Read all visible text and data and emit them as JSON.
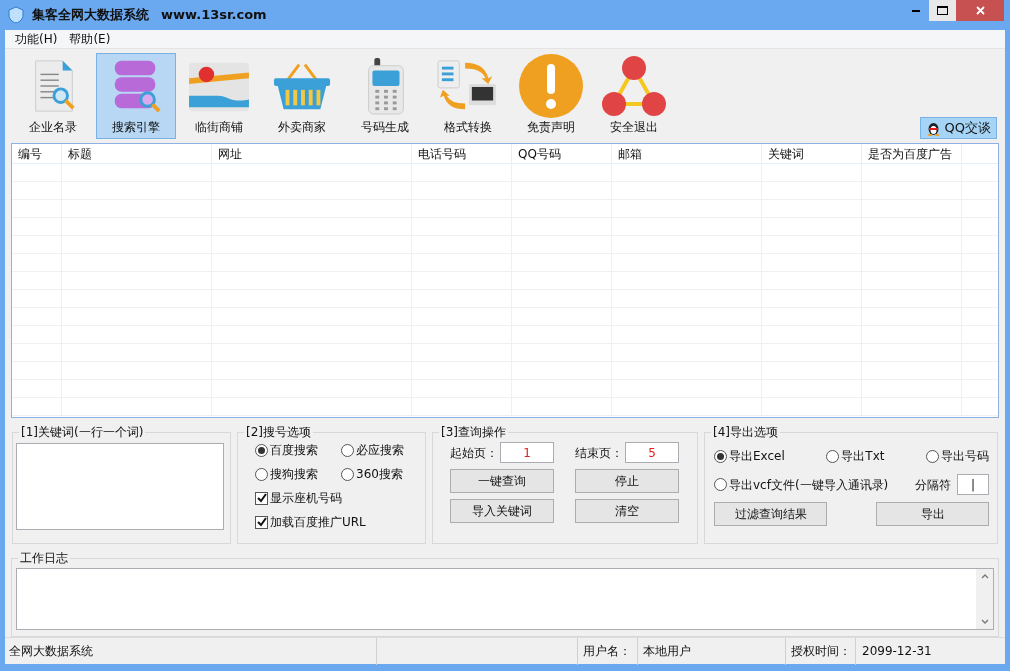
{
  "window": {
    "title": "集客全网大数据系统",
    "site": "www.13sr.com"
  },
  "menu": [
    "功能(H)",
    "帮助(E)"
  ],
  "toolbar": [
    {
      "label": "企业名录",
      "kind": "document",
      "selected": false
    },
    {
      "label": "搜索引擎",
      "kind": "database",
      "selected": true
    },
    {
      "label": "临街商铺",
      "kind": "map",
      "selected": false
    },
    {
      "label": "外卖商家",
      "kind": "basket",
      "selected": false
    },
    {
      "label": "号码生成",
      "kind": "phone",
      "selected": false
    },
    {
      "label": "格式转换",
      "kind": "convert",
      "selected": false
    },
    {
      "label": "免责声明",
      "kind": "warning",
      "selected": false
    },
    {
      "label": "安全退出",
      "kind": "nodes",
      "selected": false
    }
  ],
  "qq_button": "QQ交谈",
  "table": {
    "columns": [
      "编号",
      "标题",
      "网址",
      "电话号码",
      "QQ号码",
      "邮箱",
      "关键词",
      "是否为百度广告"
    ]
  },
  "keywords_panel": {
    "title": "[1]关键词(一行一个词)"
  },
  "search_panel": {
    "title": "[2]搜号选项",
    "engines": [
      {
        "label": "百度搜索",
        "selected": true
      },
      {
        "label": "必应搜索",
        "selected": false
      },
      {
        "label": "搜狗搜索",
        "selected": false
      },
      {
        "label": "360搜索",
        "selected": false
      }
    ],
    "options": [
      {
        "label": "显示座机号码",
        "checked": true
      },
      {
        "label": "加载百度推广URL",
        "checked": true
      }
    ]
  },
  "query_panel": {
    "title": "[3]查询操作",
    "start_label": "起始页：",
    "start_value": "1",
    "end_label": "结束页：",
    "end_value": "5",
    "buttons": [
      "一键查询",
      "停止",
      "导入关键词",
      "清空"
    ]
  },
  "export_panel": {
    "title": "[4]导出选项",
    "formats": [
      {
        "label": "导出Excel",
        "selected": true
      },
      {
        "label": "导出Txt",
        "selected": false
      },
      {
        "label": "导出号码",
        "selected": false
      },
      {
        "label": "导出vcf文件(一键导入通讯录)",
        "selected": false
      }
    ],
    "separator_label": "分隔符",
    "separator_value": "|",
    "buttons": [
      "过滤查询结果",
      "导出"
    ]
  },
  "log_panel": {
    "title": "工作日志"
  },
  "status_bar": {
    "app": "全网大数据系统",
    "user_label": "用户名：",
    "user": "本地用户",
    "license_label": "授权时间：",
    "license": "2099-12-31"
  }
}
